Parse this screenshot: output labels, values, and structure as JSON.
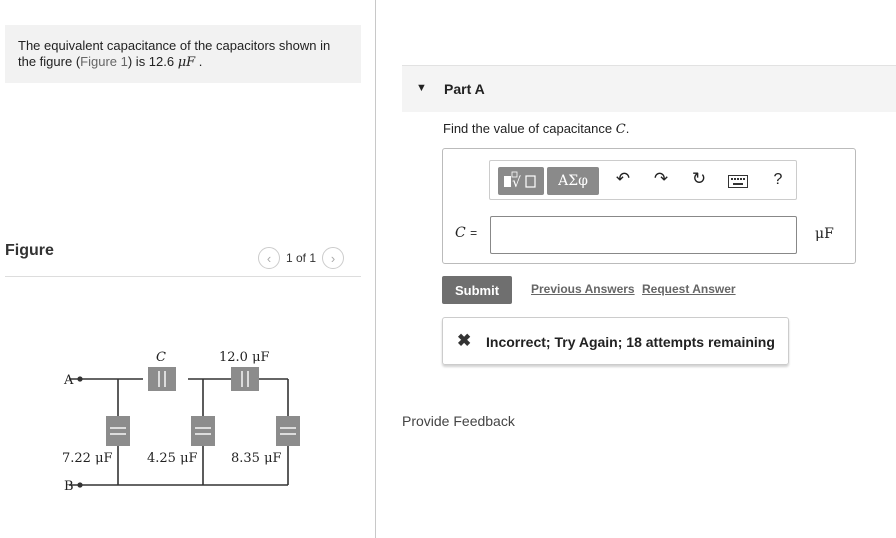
{
  "problem": {
    "text_before": "The equivalent capacitance of the capacitors shown in the figure (",
    "link": "Figure 1",
    "text_after": ") is 12.6 ",
    "unit": "μF",
    "end": " ."
  },
  "figure": {
    "title": "Figure",
    "pager": {
      "prev": "‹",
      "label": "1 of 1",
      "next": "›"
    }
  },
  "circuit": {
    "node_a": "A",
    "node_b": "B",
    "label_c": "C",
    "label_top_right": "12.0 μF",
    "label_left": "7.22 μF",
    "label_mid": "4.25 μF",
    "label_right": "8.35 μF",
    "cap_color": "#8c8c8c"
  },
  "part": {
    "arrow": "▼",
    "title": "Part A",
    "question_prefix": "Find the value of capacitance ",
    "question_var": "C",
    "question_suffix": "."
  },
  "toolbar": {
    "templates_icon": "templates-icon",
    "symbols_label": "ΑΣφ",
    "undo_icon": "↶",
    "redo_icon": "↷",
    "reset_icon": "↻",
    "keyboard_icon": "keyboard-icon",
    "help_label": "?"
  },
  "answer": {
    "var_label": "C =",
    "value": "",
    "unit": "μF"
  },
  "actions": {
    "submit": "Submit",
    "previous_answers": "Previous Answers",
    "request_answer": "Request Answer"
  },
  "feedback": {
    "icon": "✖",
    "text": "Incorrect; Try Again; 18 attempts remaining"
  },
  "provide_feedback": "Provide Feedback"
}
